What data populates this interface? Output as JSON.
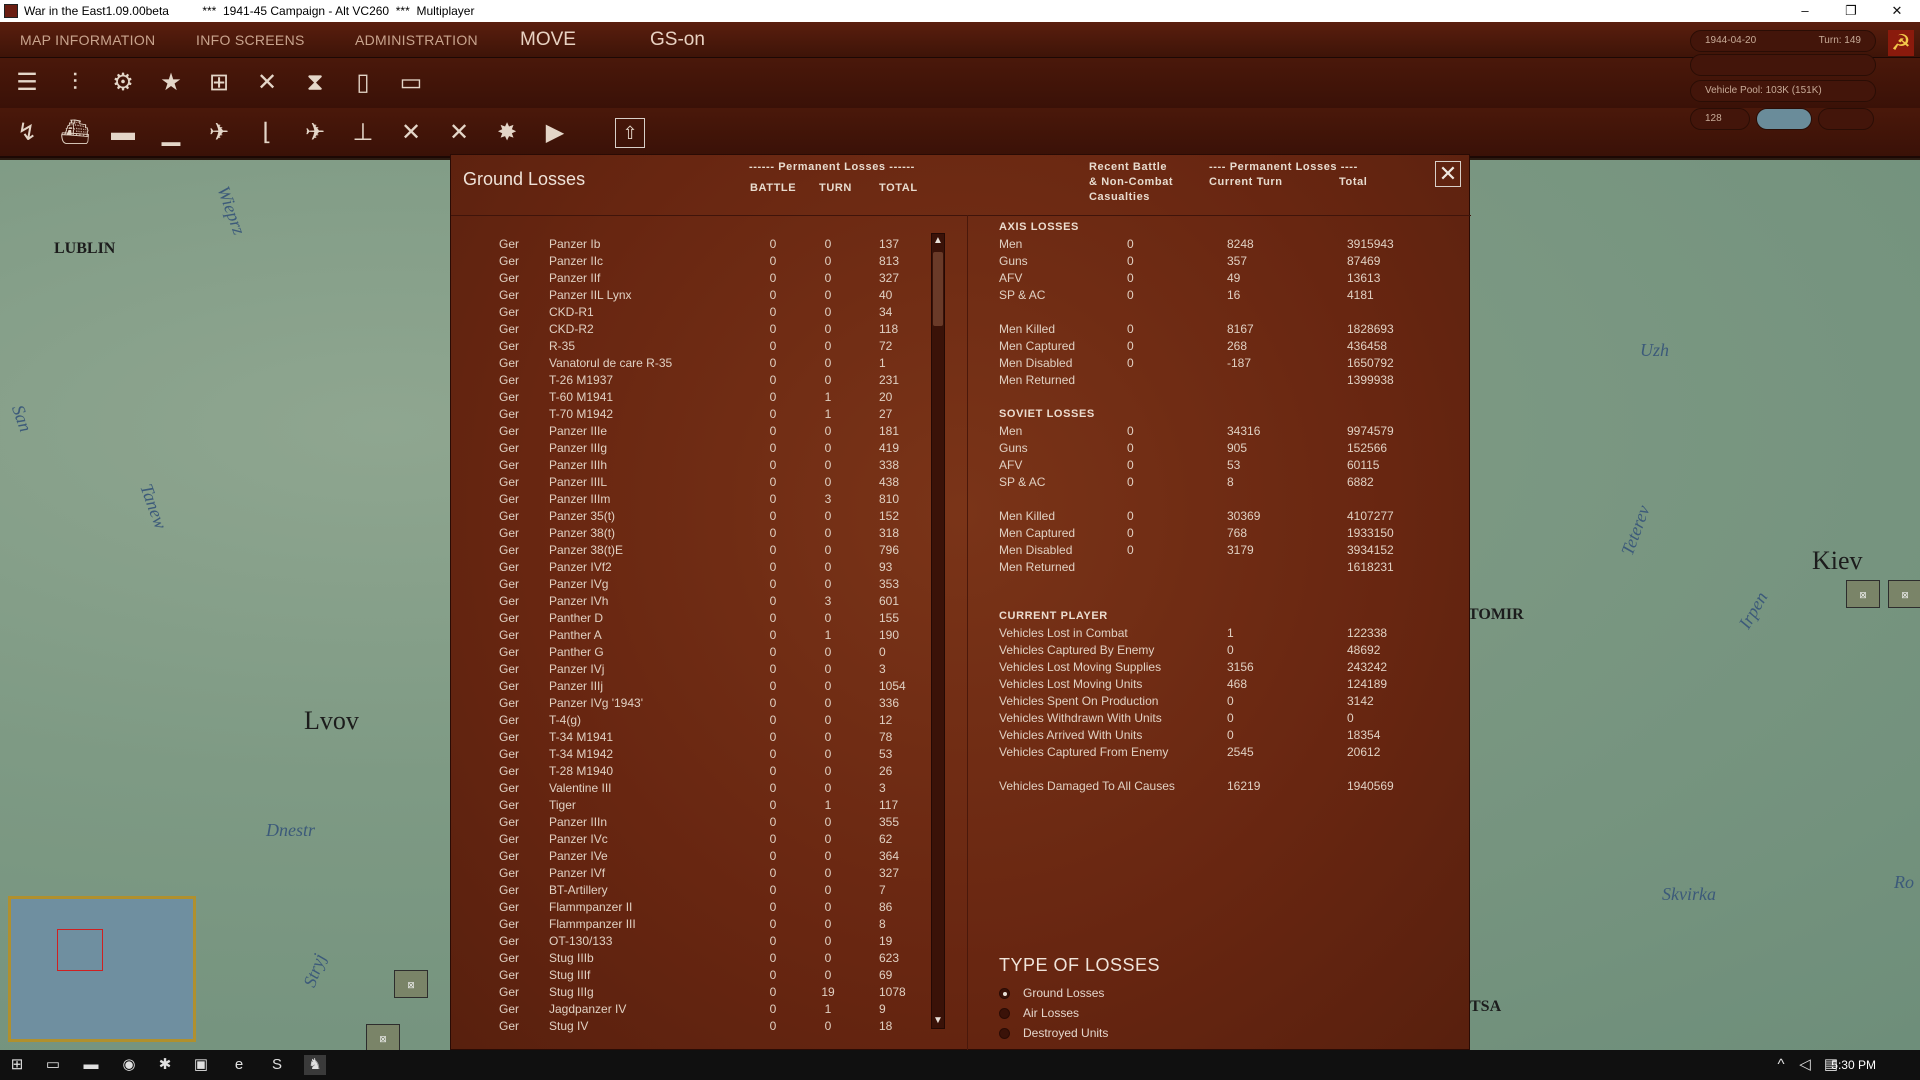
{
  "window": {
    "title": "War in the East1.09.00beta          ***  1941-45 Campaign - Alt VC260  ***  Multiplayer",
    "minimize": "–",
    "maximize": "❐",
    "close": "✕"
  },
  "menu": {
    "items": [
      "MAP INFORMATION",
      "INFO SCREENS",
      "ADMINISTRATION"
    ],
    "mode": "MOVE",
    "gs": "GS-on"
  },
  "status": {
    "date": "1944-04-20",
    "turn": "Turn: 149",
    "vehicle_pool": "Vehicle Pool: 103K (151K)",
    "value": "128"
  },
  "map": {
    "cities": [
      "LUBLIN",
      "Lvov",
      "Kiev",
      "TOMIR",
      "TSA"
    ],
    "rivers": [
      "Wieprz",
      "San",
      "Tanew",
      "Dnestr",
      "Stryj",
      "Uzh",
      "Teterev",
      "Irpen",
      "Skvirka",
      "Ro"
    ]
  },
  "dialog": {
    "title": "Ground Losses",
    "close_label": "✕",
    "headers": {
      "perm_losses": "------ Permanent Losses ------",
      "battle": "BATTLE",
      "turn": "TURN",
      "total": "TOTAL",
      "recent": "Recent Battle",
      "recent2": "& Non-Combat",
      "recent3": "Casualties",
      "perm_losses2": "---- Permanent Losses ----",
      "current_turn": "Current Turn",
      "total2": "Total"
    },
    "units": [
      [
        "Ger",
        "Panzer Ib",
        "0",
        "0",
        "137"
      ],
      [
        "Ger",
        "Panzer IIc",
        "0",
        "0",
        "813"
      ],
      [
        "Ger",
        "Panzer IIf",
        "0",
        "0",
        "327"
      ],
      [
        "Ger",
        "Panzer IIL Lynx",
        "0",
        "0",
        "40"
      ],
      [
        "Ger",
        "CKD-R1",
        "0",
        "0",
        "34"
      ],
      [
        "Ger",
        "CKD-R2",
        "0",
        "0",
        "118"
      ],
      [
        "Ger",
        "R-35",
        "0",
        "0",
        "72"
      ],
      [
        "Ger",
        "Vanatorul de care R-35",
        "0",
        "0",
        "1"
      ],
      [
        "Ger",
        "T-26 M1937",
        "0",
        "0",
        "231"
      ],
      [
        "Ger",
        "T-60 M1941",
        "0",
        "1",
        "20"
      ],
      [
        "Ger",
        "T-70 M1942",
        "0",
        "1",
        "27"
      ],
      [
        "Ger",
        "Panzer IIIe",
        "0",
        "0",
        "181"
      ],
      [
        "Ger",
        "Panzer IIIg",
        "0",
        "0",
        "419"
      ],
      [
        "Ger",
        "Panzer IIIh",
        "0",
        "0",
        "338"
      ],
      [
        "Ger",
        "Panzer IIIL",
        "0",
        "0",
        "438"
      ],
      [
        "Ger",
        "Panzer IIIm",
        "0",
        "3",
        "810"
      ],
      [
        "Ger",
        "Panzer 35(t)",
        "0",
        "0",
        "152"
      ],
      [
        "Ger",
        "Panzer 38(t)",
        "0",
        "0",
        "318"
      ],
      [
        "Ger",
        "Panzer 38(t)E",
        "0",
        "0",
        "796"
      ],
      [
        "Ger",
        "Panzer IVf2",
        "0",
        "0",
        "93"
      ],
      [
        "Ger",
        "Panzer IVg",
        "0",
        "0",
        "353"
      ],
      [
        "Ger",
        "Panzer IVh",
        "0",
        "3",
        "601"
      ],
      [
        "Ger",
        "Panther D",
        "0",
        "0",
        "155"
      ],
      [
        "Ger",
        "Panther A",
        "0",
        "1",
        "190"
      ],
      [
        "Ger",
        "Panther G",
        "0",
        "0",
        "0"
      ],
      [
        "Ger",
        "Panzer IVj",
        "0",
        "0",
        "3"
      ],
      [
        "Ger",
        "Panzer IIIj",
        "0",
        "0",
        "1054"
      ],
      [
        "Ger",
        "Panzer IVg '1943'",
        "0",
        "0",
        "336"
      ],
      [
        "Ger",
        "T-4(g)",
        "0",
        "0",
        "12"
      ],
      [
        "Ger",
        "T-34 M1941",
        "0",
        "0",
        "78"
      ],
      [
        "Ger",
        "T-34 M1942",
        "0",
        "0",
        "53"
      ],
      [
        "Ger",
        "T-28 M1940",
        "0",
        "0",
        "26"
      ],
      [
        "Ger",
        "Valentine III",
        "0",
        "0",
        "3"
      ],
      [
        "Ger",
        "Tiger",
        "0",
        "1",
        "117"
      ],
      [
        "Ger",
        "Panzer IIIn",
        "0",
        "0",
        "355"
      ],
      [
        "Ger",
        "Panzer IVc",
        "0",
        "0",
        "62"
      ],
      [
        "Ger",
        "Panzer IVe",
        "0",
        "0",
        "364"
      ],
      [
        "Ger",
        "Panzer IVf",
        "0",
        "0",
        "327"
      ],
      [
        "Ger",
        "BT-Artillery",
        "0",
        "0",
        "7"
      ],
      [
        "Ger",
        "Flammpanzer II",
        "0",
        "0",
        "86"
      ],
      [
        "Ger",
        "Flammpanzer III",
        "0",
        "0",
        "8"
      ],
      [
        "Ger",
        "OT-130/133",
        "0",
        "0",
        "19"
      ],
      [
        "Ger",
        "Stug IIIb",
        "0",
        "0",
        "623"
      ],
      [
        "Ger",
        "Stug IIIf",
        "0",
        "0",
        "69"
      ],
      [
        "Ger",
        "Stug IIIg",
        "0",
        "19",
        "1078"
      ],
      [
        "Ger",
        "Jagdpanzer IV",
        "0",
        "1",
        "9"
      ],
      [
        "Ger",
        "Stug IV",
        "0",
        "0",
        "18"
      ]
    ],
    "axis": {
      "title": "AXIS LOSSES",
      "rows": [
        [
          "Men",
          "0",
          "8248",
          "3915943"
        ],
        [
          "Guns",
          "0",
          "357",
          "87469"
        ],
        [
          "AFV",
          "0",
          "49",
          "13613"
        ],
        [
          "SP & AC",
          "0",
          "16",
          "4181"
        ],
        [
          "Men Killed",
          "0",
          "8167",
          "1828693"
        ],
        [
          "Men Captured",
          "0",
          "268",
          "436458"
        ],
        [
          "Men Disabled",
          "0",
          "-187",
          "1650792"
        ],
        [
          "Men Returned",
          "",
          "",
          "1399938"
        ]
      ]
    },
    "soviet": {
      "title": "SOVIET LOSSES",
      "rows": [
        [
          "Men",
          "0",
          "34316",
          "9974579"
        ],
        [
          "Guns",
          "0",
          "905",
          "152566"
        ],
        [
          "AFV",
          "0",
          "53",
          "60115"
        ],
        [
          "SP & AC",
          "0",
          "8",
          "6882"
        ],
        [
          "Men Killed",
          "0",
          "30369",
          "4107277"
        ],
        [
          "Men Captured",
          "0",
          "768",
          "1933150"
        ],
        [
          "Men Disabled",
          "0",
          "3179",
          "3934152"
        ],
        [
          "Men Returned",
          "",
          "",
          "1618231"
        ]
      ]
    },
    "current": {
      "title": "CURRENT PLAYER",
      "rows": [
        [
          "Vehicles Lost in Combat",
          "1",
          "122338"
        ],
        [
          "Vehicles Captured By Enemy",
          "0",
          "48692"
        ],
        [
          "Vehicles Lost Moving Supplies",
          "3156",
          "243242"
        ],
        [
          "Vehicles Lost Moving Units",
          "468",
          "124189"
        ],
        [
          "Vehicles Spent On Production",
          "0",
          "3142"
        ],
        [
          "Vehicles Withdrawn With Units",
          "0",
          "0"
        ],
        [
          "Vehicles Arrived With Units",
          "0",
          "18354"
        ],
        [
          "Vehicles Captured From Enemy",
          "2545",
          "20612"
        ],
        [
          "Vehicles Damaged To All Causes",
          "16219",
          "1940569"
        ]
      ]
    },
    "type_of_losses": {
      "title": "TYPE OF LOSSES",
      "options": [
        "Ground Losses",
        "Air Losses",
        "Destroyed Units"
      ],
      "selected": 0
    }
  },
  "taskbar": {
    "time": "5:30 PM"
  }
}
